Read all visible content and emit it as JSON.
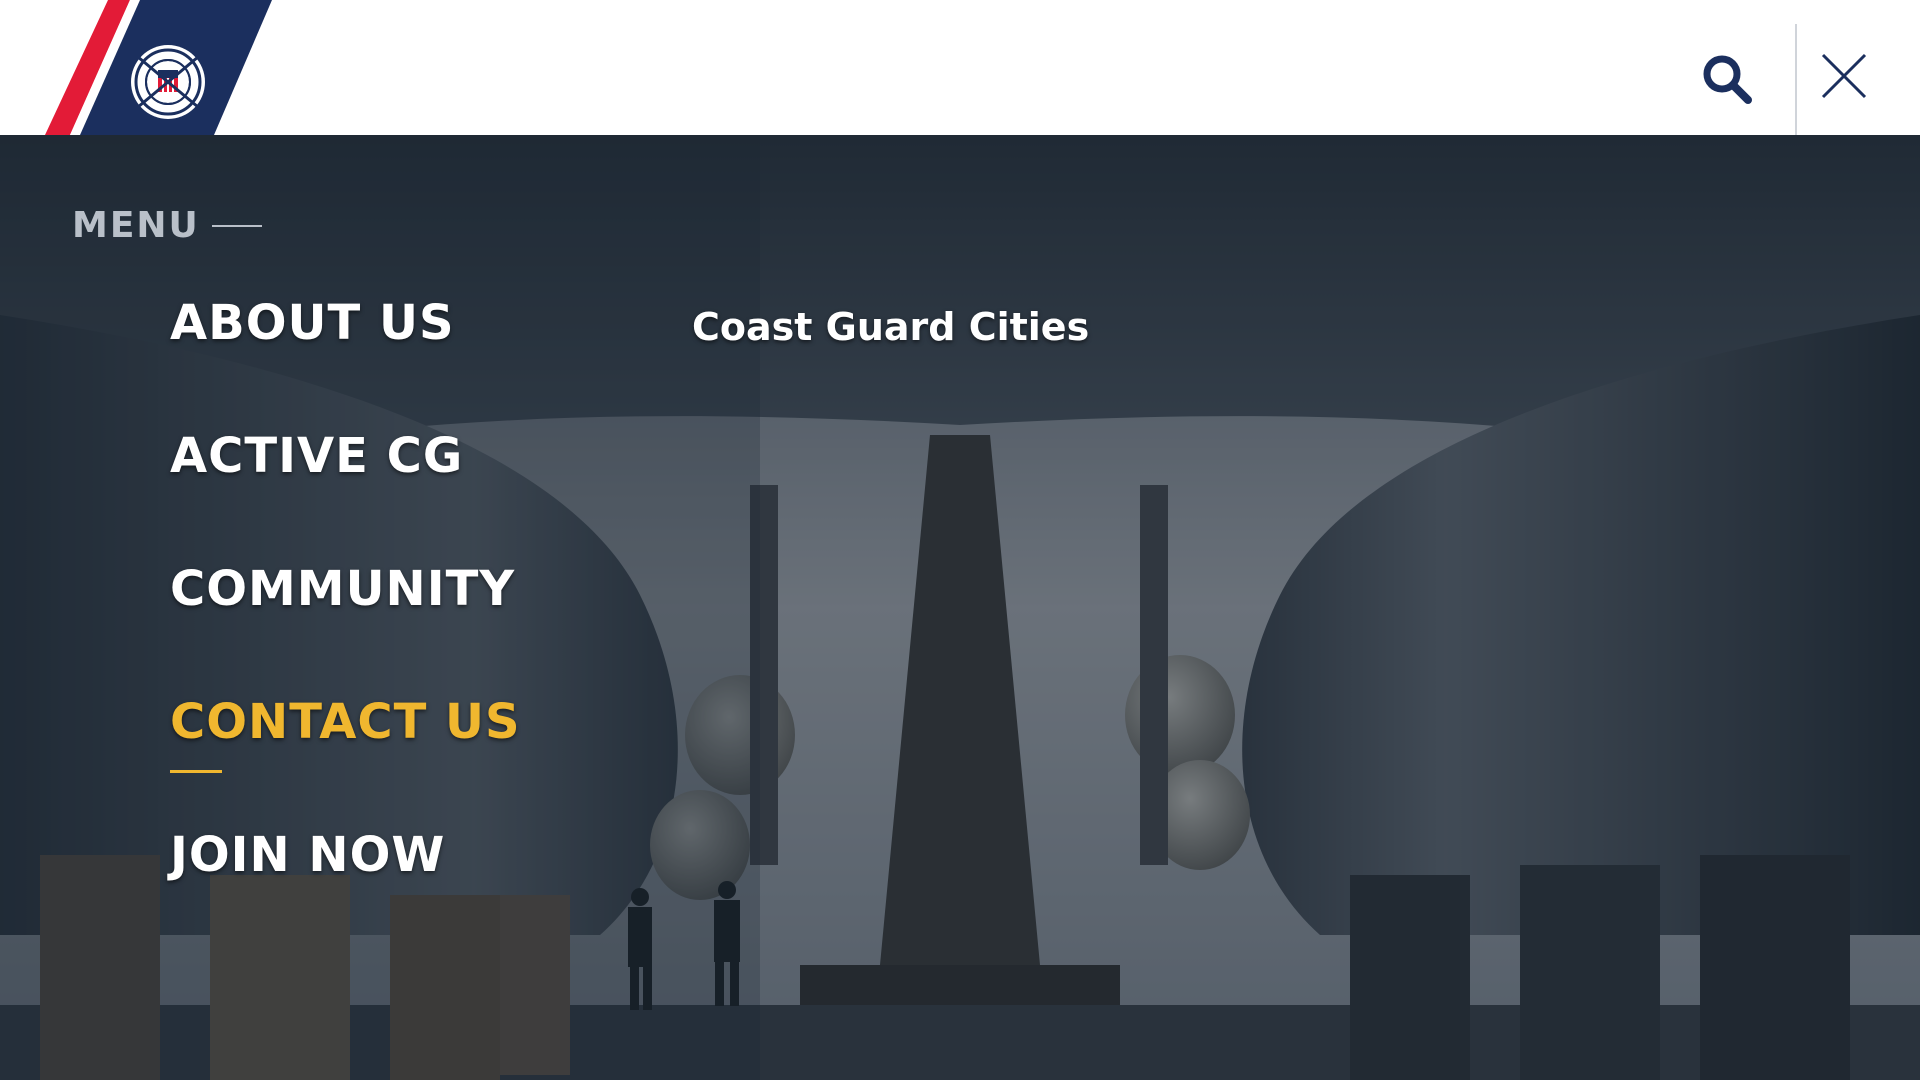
{
  "header": {
    "logo_alt": "U.S. Coast Guard emblem",
    "colors": {
      "red": "#e31b37",
      "navy": "#1b2f5e",
      "white": "#ffffff"
    },
    "search_icon": "search-icon",
    "close_icon": "close-icon"
  },
  "menu": {
    "heading": "MENU",
    "items": [
      {
        "label": "ABOUT US",
        "active": false
      },
      {
        "label": "ACTIVE CG",
        "active": false
      },
      {
        "label": "COMMUNITY",
        "active": false
      },
      {
        "label": "CONTACT US",
        "active": true
      },
      {
        "label": "JOIN NOW",
        "active": false
      }
    ],
    "sublinks": [
      {
        "label": "Coast Guard Cities"
      }
    ]
  },
  "colors": {
    "active": "#f0b72f",
    "text": "#ffffff",
    "muted": "#b9c0c9",
    "overlay": "#1c2632"
  }
}
